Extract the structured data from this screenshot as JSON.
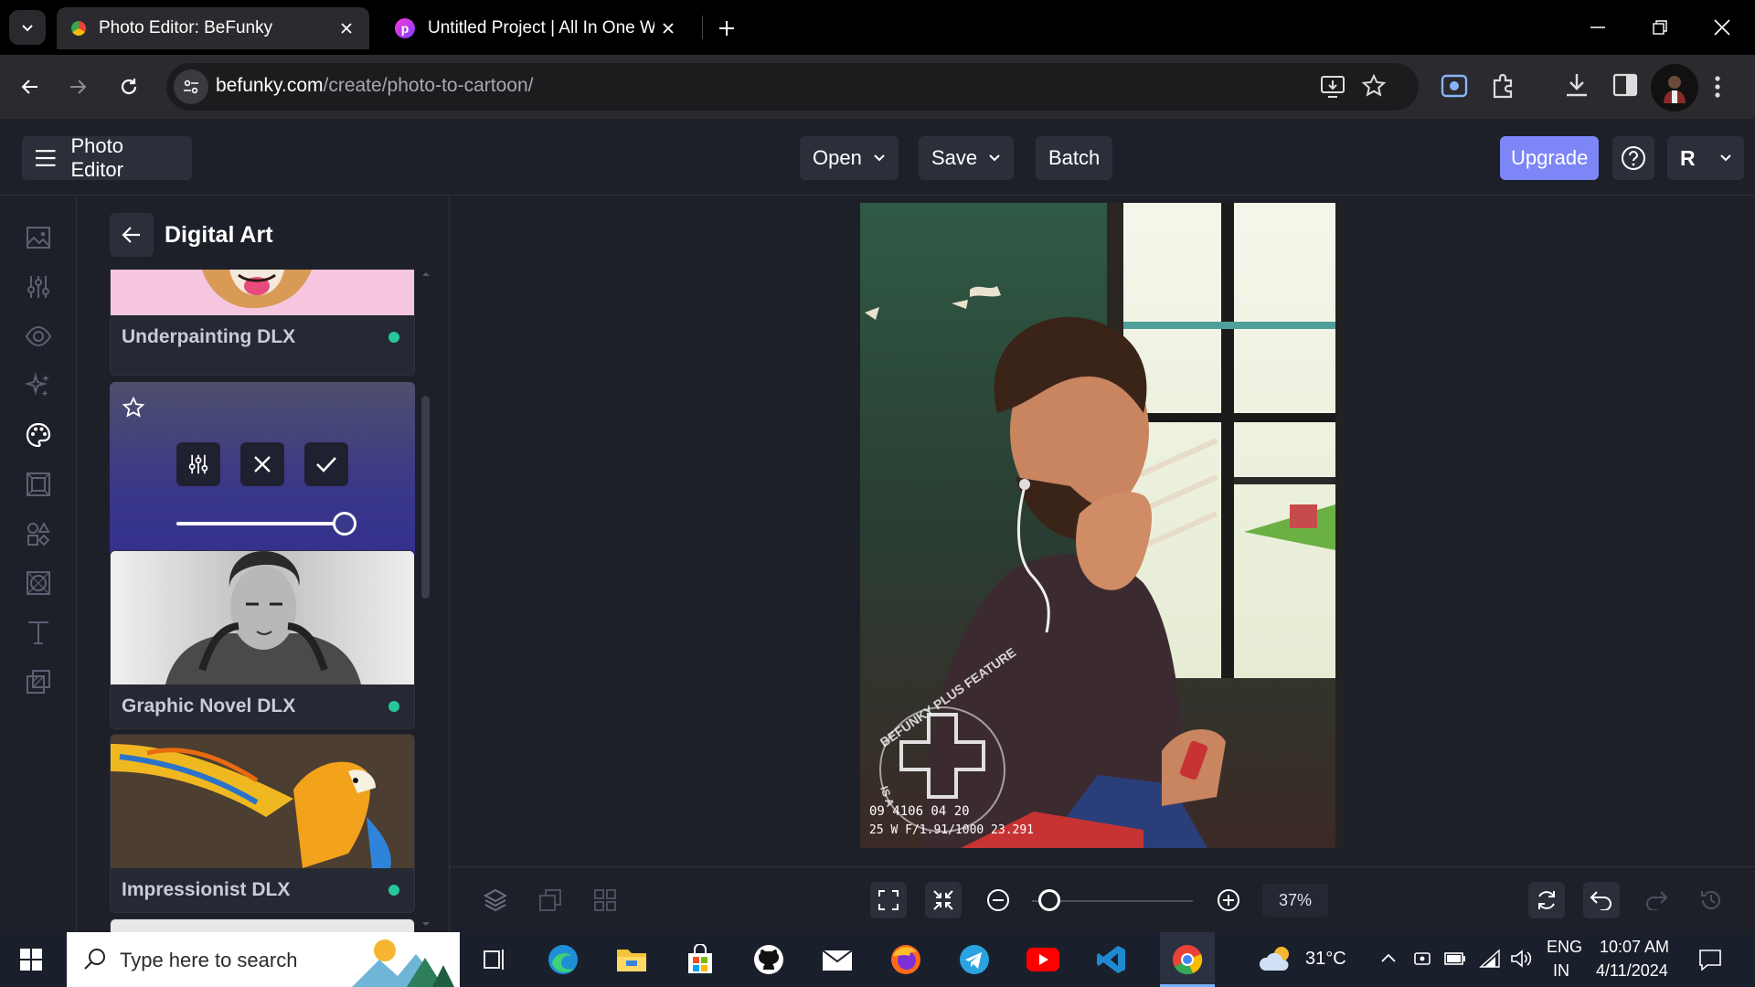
{
  "browser": {
    "tabs": [
      {
        "title": "Photo Editor: BeFunky",
        "active": true
      },
      {
        "title": "Untitled Project | All In One Wel",
        "active": false
      }
    ],
    "url_host": "befunky.com",
    "url_path": "/create/photo-to-cartoon/",
    "profile_initial": ""
  },
  "app": {
    "menu_label": "Photo Editor",
    "open_label": "Open",
    "save_label": "Save",
    "batch_label": "Batch",
    "upgrade_label": "Upgrade",
    "account_initial": "R",
    "accent": "#7d86f7"
  },
  "rail": {
    "icons": [
      "image-icon",
      "sliders-icon",
      "eye-icon",
      "sparkle-icon",
      "palette-icon",
      "frame-icon",
      "shapes-icon",
      "texture-icon",
      "text-icon",
      "overlay-icon"
    ]
  },
  "panel": {
    "title": "Digital Art",
    "effects": [
      {
        "name": "Underpainting DLX",
        "premium": true
      },
      {
        "name": "",
        "expanded": true,
        "strength": 1.0
      },
      {
        "name": "Graphic Novel DLX",
        "premium": true
      },
      {
        "name": "Impressionist DLX",
        "premium": true
      }
    ],
    "premium_color": "#28c79b"
  },
  "photo": {
    "watermark_text": "BEFUNKY PLUS FEATURE",
    "watermark_sub": "IS A",
    "stamp_line1": "09 4106 04 20",
    "stamp_line2": "25 W F/1.91/1000 23.291"
  },
  "zoom": {
    "percent": "37%",
    "level": 0.11
  },
  "taskbar": {
    "search_placeholder": "Type here to search",
    "weather": "31°C",
    "lang_top": "ENG",
    "lang_bottom": "IN",
    "time": "10:07 AM",
    "date": "4/11/2024"
  }
}
